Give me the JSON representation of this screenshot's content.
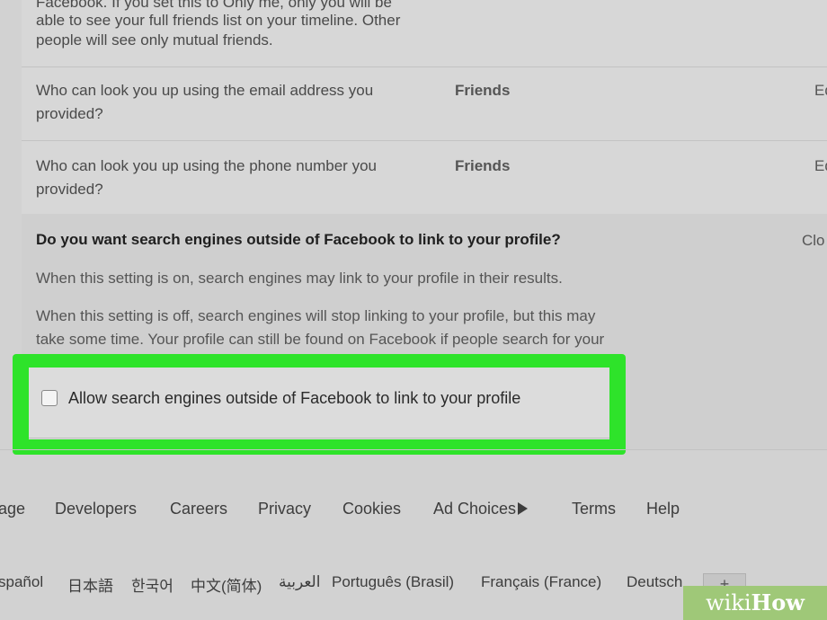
{
  "settings": {
    "top_partial_lines": [
      "Facebook. If you set this to Only me, only you will be",
      "able to see your full friends list on your timeline. Other",
      "people will see only mutual friends."
    ],
    "rows": [
      {
        "question_line1": "Who can look you up using the email address you",
        "question_line2": "provided?",
        "value": "Friends",
        "edit": "Ed"
      },
      {
        "question_line1": "Who can look you up using the phone number you",
        "question_line2": "provided?",
        "value": "Friends",
        "edit": "Ed"
      }
    ],
    "search_engines": {
      "question": "Do you want search engines outside of Facebook to link to your profile?",
      "close": "Clo",
      "desc_on": "When this setting is on, search engines may link to your profile in their results.",
      "desc_off_line1": "When this setting is off, search engines will stop linking to your profile, but this may",
      "desc_off_line2": "take some time. Your profile can still be found on Facebook if people search for your",
      "checkbox_label": "Allow search engines outside of Facebook to link to your profile",
      "checkbox_checked": false
    }
  },
  "footer": {
    "links": [
      "age",
      "Developers",
      "Careers",
      "Privacy",
      "Cookies",
      "Ad Choices",
      "Terms",
      "Help"
    ],
    "languages": [
      "spañol",
      "日本語",
      "한국어",
      "中文(简体)",
      "العربية",
      "Português (Brasil)",
      "Français (France)",
      "Deutsch"
    ],
    "more_languages": "+"
  },
  "watermark": {
    "wiki": "wiki",
    "how": "How"
  },
  "colors": {
    "highlight": "#2ee32a",
    "watermark_bg": "#9fc878"
  }
}
